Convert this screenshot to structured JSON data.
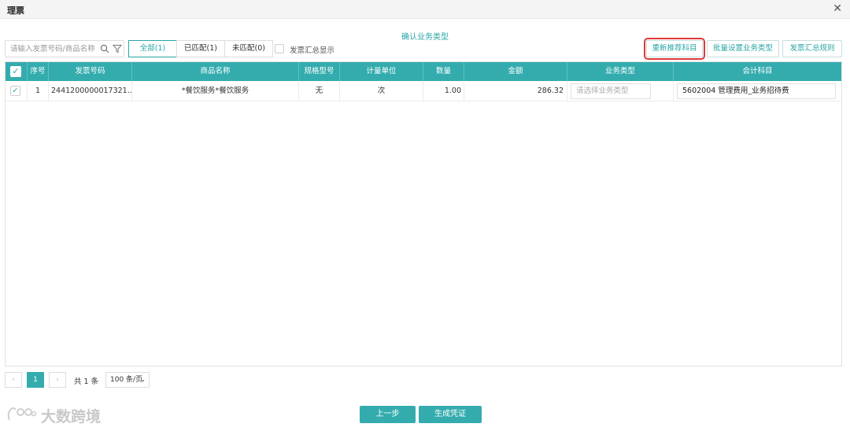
{
  "window": {
    "title": "理票"
  },
  "step_title": "确认业务类型",
  "toolbar": {
    "search_placeholder": "请输入发票号码/商品名称",
    "filters": [
      {
        "label": "全部(1)",
        "active": true
      },
      {
        "label": "已匹配(1)",
        "active": false
      },
      {
        "label": "未匹配(0)",
        "active": false
      }
    ],
    "summary_checkbox_label": "发票汇总显示",
    "summary_checked": false,
    "recommend_label": "重新推荐科目",
    "batch_set_label": "批量设置业务类型",
    "summary_rule_label": "发票汇总规则"
  },
  "table": {
    "columns": [
      "序号",
      "发票号码",
      "商品名称",
      "规格型号",
      "计量单位",
      "数量",
      "金额",
      "业务类型",
      "会计科目"
    ],
    "rows": [
      {
        "checked": true,
        "index": "1",
        "invoice_no": "2441200000017321...",
        "product": "*餐饮服务*餐饮服务",
        "spec": "无",
        "unit": "次",
        "qty": "1.00",
        "amount": "286.32",
        "biz_type_placeholder": "请选择业务类型",
        "account": "5602004 管理费用_业务招待费"
      }
    ]
  },
  "pagination": {
    "prev": "‹",
    "current_page": "1",
    "next": "›",
    "total": "共 1 条",
    "page_size": "100 条/页"
  },
  "footer": {
    "prev_label": "上一步",
    "generate_label": "生成凭证"
  },
  "watermark": {
    "text": "大数跨境"
  },
  "colors": {
    "accent": "#34acae",
    "highlight": "#e03a3a"
  }
}
